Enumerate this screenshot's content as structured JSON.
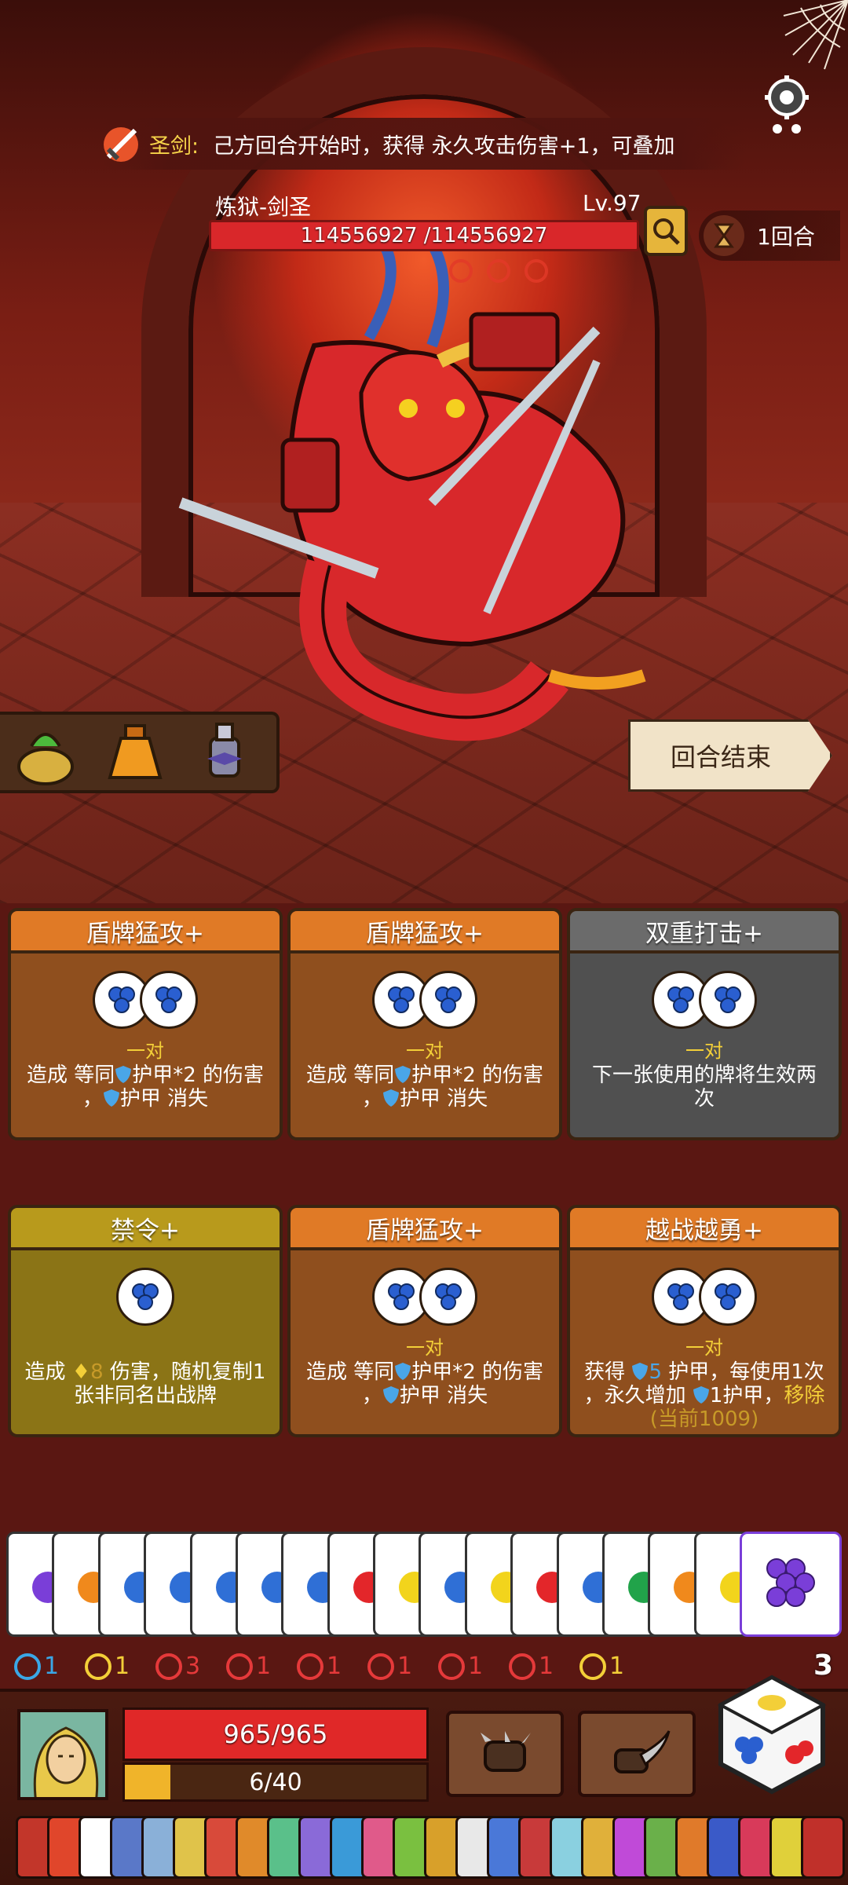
{
  "banner": {
    "tag": "圣剑:",
    "text": "己方回合开始时，获得 永久攻击伤害+1，可叠加"
  },
  "boss": {
    "name": "炼狱-剑圣",
    "level": "Lv.97",
    "hp_text": "114556927 /114556927",
    "hp_fraction": 1.0
  },
  "round": {
    "label": "1回合"
  },
  "end_turn": {
    "label": "回合结束"
  },
  "cards": [
    {
      "title": "盾牌猛攻+",
      "style": "orange",
      "dice": 2,
      "pair": "一对",
      "desc_a": "造成 等同",
      "desc_b": "护甲*2 的伤害",
      "desc_c": "，",
      "desc_d": "护甲 消失"
    },
    {
      "title": "盾牌猛攻+",
      "style": "orange",
      "dice": 2,
      "pair": "一对",
      "desc_a": "造成 等同",
      "desc_b": "护甲*2 的伤害",
      "desc_c": "，",
      "desc_d": "护甲 消失"
    },
    {
      "title": "双重打击+",
      "style": "gray",
      "dice": 2,
      "pair": "一对",
      "desc_a": "下一张使用的牌将生效两",
      "desc_b": "次"
    },
    {
      "title": "禁令+",
      "style": "gold",
      "dice": 1,
      "desc_a": "造成",
      "value": "8",
      "desc_b": "伤害，随机复制1",
      "desc_c": "张非同名出战牌"
    },
    {
      "title": "盾牌猛攻+",
      "style": "orange",
      "dice": 2,
      "pair": "一对",
      "desc_a": "造成 等同",
      "desc_b": "护甲*2 的伤害",
      "desc_c": "，",
      "desc_d": "护甲 消失"
    },
    {
      "title": "越战越勇+",
      "style": "orange",
      "dice": 2,
      "pair": "一对",
      "desc_a": "获得",
      "value": "5",
      "desc_b": "护甲，每使用1次",
      "desc_c": "，永久增加",
      "desc_d": "1护甲，",
      "remove": "移除",
      "current": "(当前1009)"
    }
  ],
  "hand_colors": [
    "#7a3ed8",
    "#f0891c",
    "#2f6fd6",
    "#2f6fd6",
    "#2f6fd6",
    "#2f6fd6",
    "#2f6fd6",
    "#e3262a",
    "#f2d41c",
    "#2f6fd6",
    "#f2d41c",
    "#e3262a",
    "#2f6fd6",
    "#21a34a",
    "#f0891c",
    "#f2d41c"
  ],
  "stats": [
    {
      "icon": "swirl-icon",
      "value": "1",
      "color": "#3aa7e6"
    },
    {
      "icon": "shield-icon",
      "value": "1",
      "color": "#f3cf38"
    },
    {
      "icon": "heart-icon",
      "value": "3",
      "color": "#e5393a"
    },
    {
      "icon": "target-icon",
      "value": "1",
      "color": "#e5393a"
    },
    {
      "icon": "sword-shield-icon",
      "value": "1",
      "color": "#e5393a"
    },
    {
      "icon": "claw-icon",
      "value": "1",
      "color": "#e5393a"
    },
    {
      "icon": "spiral-icon",
      "value": "1",
      "color": "#e5393a"
    },
    {
      "icon": "blade-icon",
      "value": "1",
      "color": "#e5393a"
    },
    {
      "icon": "burst-icon",
      "value": "1",
      "color": "#f3cf38"
    }
  ],
  "deck_count": "3",
  "player": {
    "hp_text": "965/965",
    "energy_text": "6/40",
    "energy_fraction": 0.15
  },
  "deck_strip_colors": [
    "#c2362a",
    "#e0462b",
    "#ffffff",
    "#5a78c8",
    "#8ab0d8",
    "#e0c34a",
    "#d84a3a",
    "#e08a2a",
    "#5ac08a",
    "#8a6ad8",
    "#3a9ad8",
    "#e05a8a",
    "#7ac040",
    "#d8a02a",
    "#e8e8e8",
    "#4a78d8",
    "#c83a3a",
    "#8ad0e0",
    "#e0b03a",
    "#c04ad8",
    "#6ab04a",
    "#e07a2a",
    "#3a5ac8",
    "#d83a5a",
    "#e0d03a",
    "#c0302a"
  ]
}
